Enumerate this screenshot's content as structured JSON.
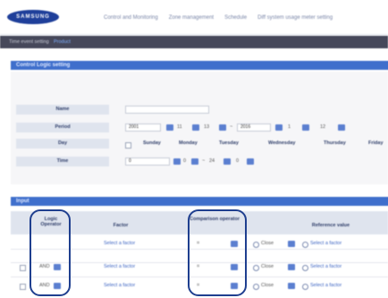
{
  "header": {
    "logo_text": "SAMSUNG",
    "nav": [
      "Control and Monitoring",
      "Zone management",
      "Schedule",
      "Diff system usage meter setting"
    ]
  },
  "breadcrumb": {
    "prefix": "Time event setting",
    "current": "Product"
  },
  "form_section": {
    "title": "Control Logic setting",
    "name_label": "Name",
    "name_value": "",
    "period_label": "Period",
    "period_values": [
      "2001",
      "11",
      "13",
      "2016",
      "1",
      "12"
    ],
    "day_label": "Day",
    "days": [
      "Sunday",
      "Monday",
      "Tuesday",
      "Wednesday",
      "Thursday",
      "Friday"
    ],
    "time_label": "Time",
    "time_values": [
      "0",
      "0",
      "24",
      "0"
    ]
  },
  "input_section": {
    "title": "Input",
    "columns": {
      "logic_operator": "Logic Operator",
      "factor": "Factor",
      "comparison_operator": "Comparison operator",
      "reference_value": "Reference value"
    },
    "rows": [
      {
        "logic": "",
        "factor": "Select a factor",
        "operator": "=",
        "mode": "Close",
        "reference": "Select a factor"
      },
      {
        "logic": "AND",
        "factor": "Select a factor",
        "operator": "=",
        "mode": "Close",
        "reference": "Select a factor"
      },
      {
        "logic": "AND",
        "factor": "Select a factor",
        "operator": "=",
        "mode": "Close",
        "reference": "Select a factor"
      }
    ]
  },
  "colors": {
    "accent": "#3f6fcc",
    "header_band": "#46485a",
    "highlight_ring": "#1f3f8f"
  }
}
